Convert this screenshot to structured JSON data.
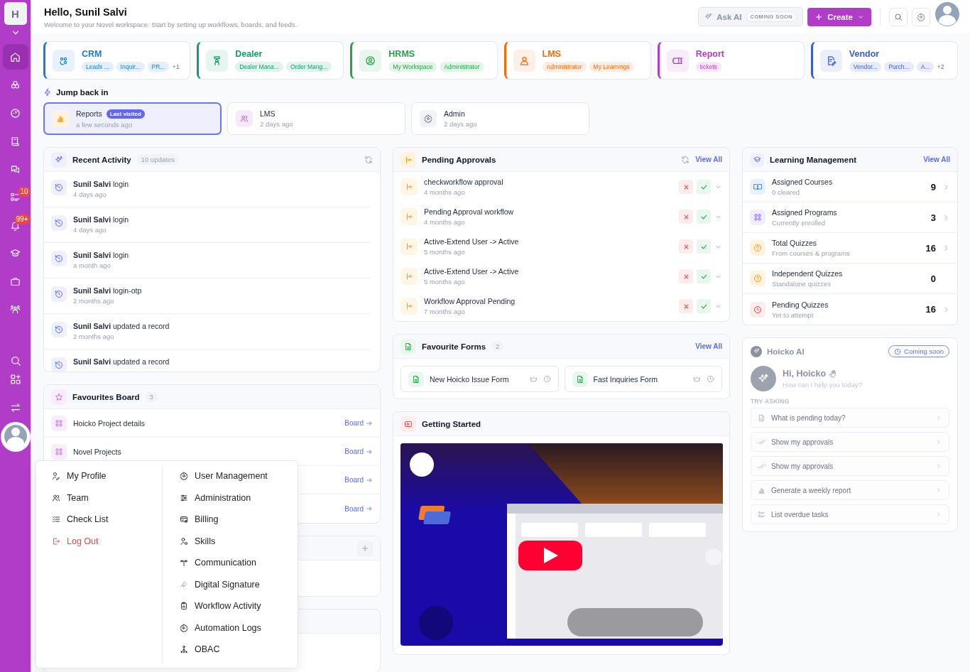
{
  "sidebar": {
    "logo": "H",
    "items": [
      {
        "selected": true
      },
      {
        "selected": false
      },
      {
        "selected": false
      },
      {
        "selected": false
      },
      {
        "selected": false
      },
      {
        "selected": false,
        "badge": "10"
      },
      {
        "selected": false,
        "badge": "99+"
      },
      {
        "selected": false
      },
      {
        "selected": false
      },
      {
        "selected": false
      }
    ],
    "bottom_items": [
      {
        "selected": false
      },
      {
        "selected": false
      },
      {
        "selected": false
      }
    ]
  },
  "header": {
    "greeting": "Hello, Sunil Salvi",
    "subtitle": "Welcome to your Novel workspace. Start by setting up workflows, boards, and feeds.",
    "ask_ai": {
      "label": "Ask AI",
      "badge": "COMING SOON",
      "disabled": true
    },
    "create_button": "Create"
  },
  "apps": [
    {
      "name": "CRM",
      "color": "#1a7dd6",
      "tags": [
        "Leads ...",
        "Inquir...",
        "PR..."
      ],
      "more": "+1"
    },
    {
      "name": "Dealer",
      "color": "#0f9d6b",
      "tags": [
        "Dealer Mana...",
        "Order Mang..."
      ]
    },
    {
      "name": "HRMS",
      "color": "#22a447",
      "tags": [
        "My Workspace",
        "Administrator"
      ]
    },
    {
      "name": "LMS",
      "color": "#f26b0a",
      "tags": [
        "Administrator",
        "My Learnings"
      ]
    },
    {
      "name": "Report",
      "color": "#b23cc8",
      "tags": [
        "tickets"
      ]
    },
    {
      "name": "Vendor",
      "color": "#3b5bdb",
      "tags": [
        "Vendor...",
        "Purch...",
        "A..."
      ],
      "more": "+2"
    }
  ],
  "jump_back": {
    "title": "Jump back in",
    "items": [
      {
        "name": "Reports",
        "badge": "Last visited",
        "time": "a few seconds ago",
        "selected": true
      },
      {
        "name": "LMS",
        "time": "2 days ago",
        "selected": false
      },
      {
        "name": "Admin",
        "time": "2 days ago",
        "selected": false
      }
    ]
  },
  "recent_activity": {
    "title": "Recent Activity",
    "count": "10 updates",
    "items": [
      {
        "text": "**Sunil Salvi** login",
        "time": "4 days ago"
      },
      {
        "text": "**Sunil Salvi** login",
        "time": "4 days ago"
      },
      {
        "text": "**Sunil Salvi** login",
        "time": "a month ago"
      },
      {
        "text": "**Sunil Salvi** login-otp",
        "time": "2 months ago"
      },
      {
        "text": "**Sunil Salvi** updated a record",
        "time": "2 months ago"
      },
      {
        "text": "**Sunil Salvi** updated a record"
      }
    ]
  },
  "favourites_board": {
    "title": "Favourites Board",
    "count": "3",
    "rows": [
      {
        "name": "Hoicko Project details",
        "link": "Board"
      },
      {
        "name": "Novel Projects",
        "link": "Board"
      },
      {
        "link": "Board"
      },
      {
        "link": "Board"
      }
    ]
  },
  "covered_panels": [
    {
      "add_button": true
    },
    {
      "add_button": false
    }
  ],
  "pending_approvals": {
    "title": "Pending Approvals",
    "view_all": "View All",
    "items": [
      {
        "title": "checkworkflow approval",
        "time": "4 months ago"
      },
      {
        "title": "Pending Approval workflow",
        "time": "4 months ago"
      },
      {
        "title": "Active-Extend User -> Active",
        "time": "5 months ago"
      },
      {
        "title": "Active-Extend User -> Active",
        "time": "5 months ago"
      },
      {
        "title": "Workflow Approval Pending",
        "time": "7 months ago"
      }
    ]
  },
  "favourite_forms": {
    "title": "Favourite Forms",
    "count": "2",
    "view_all": "View All",
    "forms": [
      "New Hoicko Issue Form",
      "Fast Inquiries Form"
    ]
  },
  "getting_started": {
    "title": "Getting Started"
  },
  "learning": {
    "title": "Learning Management",
    "view_all": "View All",
    "items": [
      {
        "title": "Assigned Courses",
        "subtitle": "0 cleared",
        "count": "9",
        "chevron": true
      },
      {
        "title": "Assigned Programs",
        "subtitle": "Currently enrolled",
        "count": "3",
        "chevron": true
      },
      {
        "title": "Total Quizzes",
        "subtitle": "From courses & programs",
        "count": "16",
        "chevron": true
      },
      {
        "title": "Independent Quizzes",
        "subtitle": "Standalone quizzes",
        "count": "0",
        "chevron": false
      },
      {
        "title": "Pending Quizzes",
        "subtitle": "Yet to attempt",
        "count": "16",
        "chevron": true
      }
    ]
  },
  "hoicko_ai": {
    "title": "Hoicko AI",
    "badge": "Coming soon",
    "disabled": true,
    "greeting": "Hi, Hoicko",
    "prompt": "How can I help you today?",
    "try_label": "TRY ASKING",
    "suggestions": [
      "What is pending today?",
      "Show my approvals",
      "Show my approvals",
      "Generate a weekly report",
      "List overdue tasks"
    ]
  },
  "profile_menu": {
    "left": [
      {
        "label": "My Profile",
        "kind": "normal"
      },
      {
        "label": "Team",
        "kind": "normal"
      },
      {
        "label": "Check List",
        "kind": "normal"
      },
      {
        "label": "Log Out",
        "kind": "danger"
      }
    ],
    "right": [
      "User Management",
      "Administration",
      "Billing",
      "Skills",
      "Communication",
      "Digital Signature",
      "Workflow Activity",
      "Automation Logs",
      "OBAC"
    ]
  }
}
